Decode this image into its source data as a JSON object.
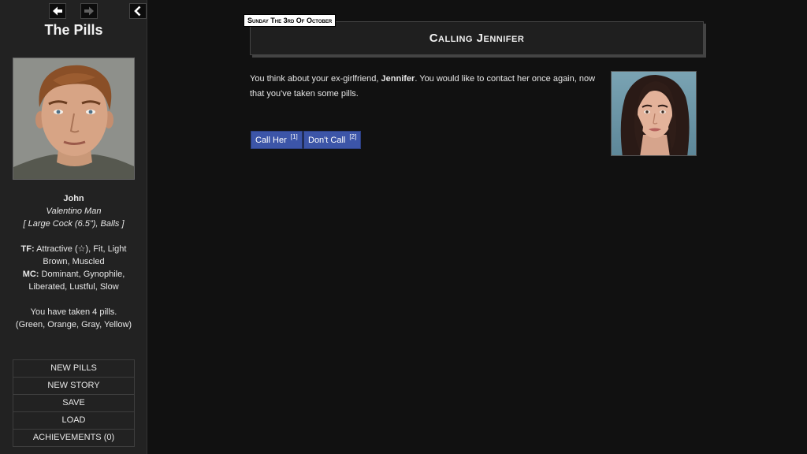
{
  "sidebar": {
    "story_title": "The Pills",
    "character": {
      "name": "John",
      "title": "Valentino Man",
      "anatomy": "[ Large Cock (6.5\"), Balls ]",
      "tf_label": "TF:",
      "tf_line1": " Attractive (☆), Fit, Light",
      "tf_line2": "Brown, Muscled",
      "mc_label": "MC:",
      "mc_line1": " Dominant, Gynophile,",
      "mc_line2": "Liberated, Lustful, Slow",
      "pills_line1": "You have taken 4 pills.",
      "pills_line2": "(Green, Orange, Gray, Yellow)"
    },
    "menu": [
      "NEW PILLS",
      "NEW STORY",
      "SAVE",
      "LOAD",
      "ACHIEVEMENTS (0)"
    ]
  },
  "passage": {
    "date": "Sunday The 3rd Of October",
    "title": "Calling Jennifer",
    "text_before": "You think about your ex-girlfriend, ",
    "text_name": "Jennifer",
    "text_after": ". You would like to contact her once again, now that you've taken some pills.",
    "choices": [
      {
        "label": "Call Her ",
        "key": "[1]"
      },
      {
        "label": "Don't Call ",
        "key": "[2]"
      }
    ]
  },
  "icons": {
    "back": "arrow-left-icon",
    "forward": "arrow-right-icon",
    "collapse": "chevron-left-icon"
  },
  "colors": {
    "choice_button": "#3c55a8",
    "background": "#111111",
    "sidebar": "#222222"
  }
}
